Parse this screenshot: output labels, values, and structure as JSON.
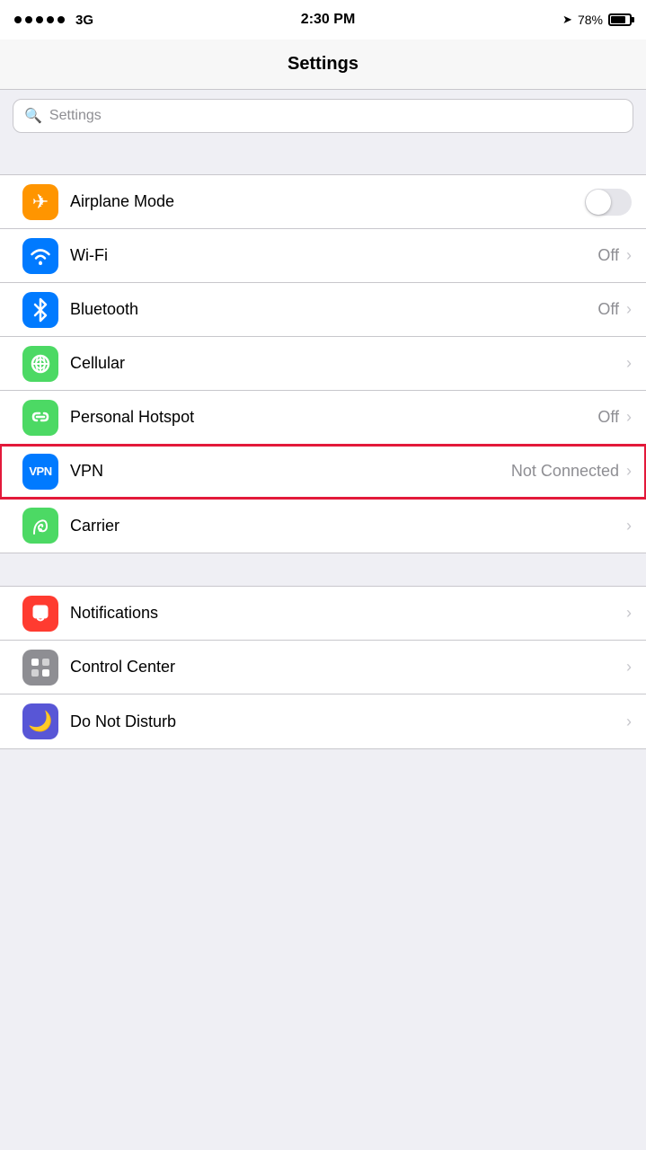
{
  "statusBar": {
    "signal": "3G",
    "time": "2:30 PM",
    "battery": "78%"
  },
  "navBar": {
    "title": "Settings"
  },
  "search": {
    "placeholder": "Settings"
  },
  "groups": [
    {
      "id": "network",
      "rows": [
        {
          "id": "airplane-mode",
          "icon": "✈",
          "iconBg": "bg-orange",
          "label": "Airplane Mode",
          "value": "",
          "hasToggle": true,
          "toggleOn": false,
          "hasChevron": false,
          "highlighted": false
        },
        {
          "id": "wifi",
          "icon": "wifi",
          "iconBg": "bg-blue",
          "label": "Wi-Fi",
          "value": "Off",
          "hasToggle": false,
          "hasChevron": true,
          "highlighted": false
        },
        {
          "id": "bluetooth",
          "icon": "bt",
          "iconBg": "bg-blue",
          "label": "Bluetooth",
          "value": "Off",
          "hasToggle": false,
          "hasChevron": true,
          "highlighted": false
        },
        {
          "id": "cellular",
          "icon": "cell",
          "iconBg": "bg-green-teal",
          "label": "Cellular",
          "value": "",
          "hasToggle": false,
          "hasChevron": true,
          "highlighted": false
        },
        {
          "id": "personal-hotspot",
          "icon": "hotspot",
          "iconBg": "bg-green",
          "label": "Personal Hotspot",
          "value": "Off",
          "hasToggle": false,
          "hasChevron": true,
          "highlighted": false
        },
        {
          "id": "vpn",
          "icon": "VPN",
          "iconBg": "bg-vpn-blue",
          "label": "VPN",
          "value": "Not Connected",
          "hasToggle": false,
          "hasChevron": true,
          "highlighted": true
        },
        {
          "id": "carrier",
          "icon": "phone",
          "iconBg": "bg-green",
          "label": "Carrier",
          "value": "",
          "hasToggle": false,
          "hasChevron": true,
          "highlighted": false
        }
      ]
    },
    {
      "id": "system",
      "rows": [
        {
          "id": "notifications",
          "icon": "notif",
          "iconBg": "bg-red",
          "label": "Notifications",
          "value": "",
          "hasToggle": false,
          "hasChevron": true,
          "highlighted": false
        },
        {
          "id": "control-center",
          "icon": "ctrl",
          "iconBg": "bg-gray",
          "label": "Control Center",
          "value": "",
          "hasToggle": false,
          "hasChevron": true,
          "highlighted": false
        },
        {
          "id": "do-not-disturb",
          "icon": "moon",
          "iconBg": "bg-purple",
          "label": "Do Not Disturb",
          "value": "",
          "hasToggle": false,
          "hasChevron": true,
          "highlighted": false
        }
      ]
    }
  ]
}
